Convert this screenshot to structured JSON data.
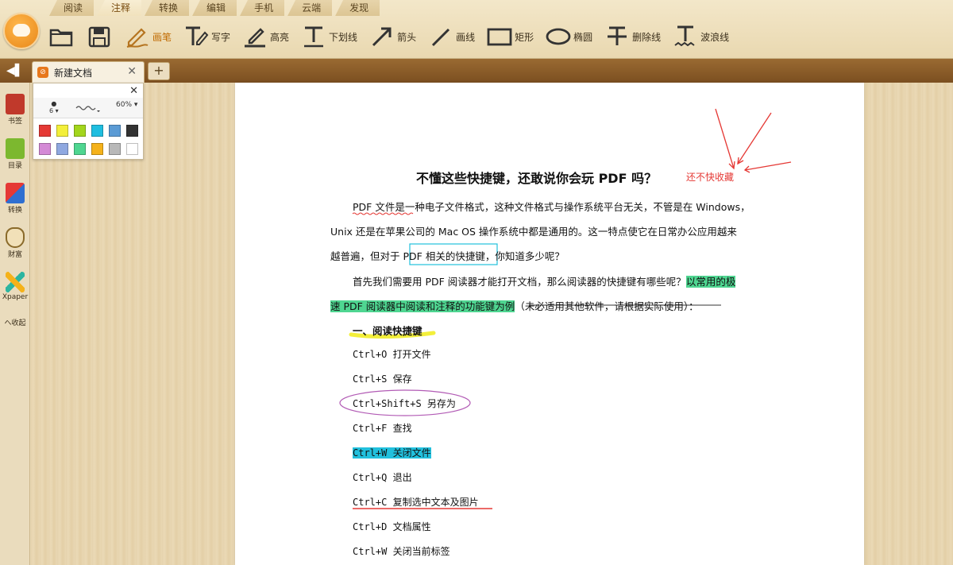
{
  "menu": {
    "tabs": [
      "阅读",
      "注释",
      "转换",
      "编辑",
      "手机",
      "云端",
      "发现"
    ],
    "active": "注释"
  },
  "toolbar": {
    "tools": [
      {
        "icon": "folder-open-icon",
        "label": ""
      },
      {
        "icon": "save-icon",
        "label": ""
      },
      {
        "icon": "pencil-icon",
        "label": "画笔"
      },
      {
        "icon": "text-pen-icon",
        "label": "写字"
      },
      {
        "icon": "highlighter-icon",
        "label": "高亮"
      },
      {
        "icon": "underline-icon",
        "label": "下划线"
      },
      {
        "icon": "arrow-icon",
        "label": "箭头"
      },
      {
        "icon": "line-icon",
        "label": "画线"
      },
      {
        "icon": "rectangle-icon",
        "label": "矩形"
      },
      {
        "icon": "ellipse-icon",
        "label": "椭圆"
      },
      {
        "icon": "strikethrough-icon",
        "label": "删除线"
      },
      {
        "icon": "wavy-underline-icon",
        "label": "波浪线"
      }
    ],
    "selected": "画笔"
  },
  "tabs": {
    "doc_tab_title": "新建文档",
    "new_tab_label": "+"
  },
  "sidebar": {
    "items": [
      {
        "icon": "bookmark-icon",
        "label": "书签"
      },
      {
        "icon": "outline-icon",
        "label": "目录"
      },
      {
        "icon": "convert-icon",
        "label": "转换"
      },
      {
        "icon": "wealth-icon",
        "label": "财富"
      },
      {
        "icon": "xpaper-icon",
        "label": "Xpaper"
      }
    ],
    "collapse_label": "へ收起"
  },
  "palette": {
    "size_value": "6",
    "opacity_value": "60%",
    "colors": [
      "#e53935",
      "#f3ef3a",
      "#a3d61c",
      "#1fbee0",
      "#5b9bd5",
      "#333333",
      "#d48ad6",
      "#8fa8e0",
      "#4fd691",
      "#f5b21a",
      "#b8b8b8",
      "#ffffff"
    ]
  },
  "document": {
    "title": "不懂这些快捷键，还敢说你会玩 PDF 吗？",
    "annotation": "还不快收藏",
    "para1_line1": "PDF 文件是一种电子文件格式，这种文件格式与操作系统平台无关，不管是在 Windows，",
    "para1_line2": "Unix 还是在苹果公司的 Mac OS 操作系统中都是通用的。这一特点使它在日常办公应用越来",
    "para1_line3a": "越普遍，但对于",
    "para1_line3b": "PDF 相关的快捷键",
    "para1_line3c": "，你知道多少呢？",
    "para2_line1a": "首先我们需要用 PDF 阅读器才能打开文档，那么阅读器的快捷键有哪些呢？",
    "para2_line1b": "以常用的极",
    "para2_line2a": "速 PDF 阅读器中阅读和注释的功能键为例",
    "para2_line2b": "（未必适用其他软件，请根据实际使用）：",
    "section1": "一、阅读快捷键",
    "shortcuts": [
      "Ctrl+O 打开文件",
      "Ctrl+S 保存",
      "Ctrl+Shift+S 另存为",
      "Ctrl+F 查找",
      "Ctrl+W 关闭文件",
      "Ctrl+Q 退出",
      "Ctrl+C 复制选中文本及图片",
      "Ctrl+D 文档属性",
      "Ctrl+W 关闭当前标签"
    ]
  },
  "colors": {
    "accent": "#c06a00",
    "annotation_red": "#e53935",
    "highlight_green": "#4fd691",
    "highlight_cyan": "#21c0dd",
    "highlight_yellow": "#f3ef3a",
    "ellipse_purple": "#b25bb5"
  }
}
